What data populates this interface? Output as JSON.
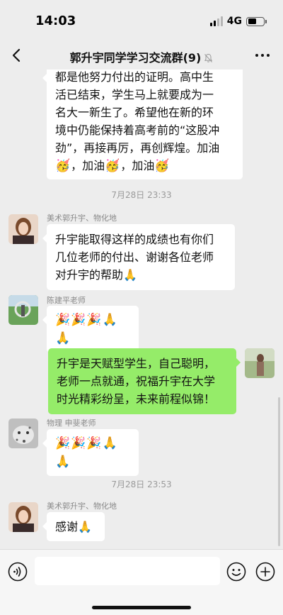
{
  "status": {
    "time": "14:03",
    "network": "4G"
  },
  "header": {
    "title": "郭升宇同学学习交流群(9)"
  },
  "messages": {
    "top_partial": {
      "lines": [
        "都是他努力付出的证明。高中生",
        "活已结束，学生马上就要成为一",
        "名大一新生了。希望他在新的环",
        "境中仍能保持着高考前的“这股冲",
        "劲”，再接再厉，再创辉煌。加油"
      ],
      "last_line": [
        "🥳",
        "，加油",
        "🥳",
        "，加油",
        "🥳"
      ]
    },
    "ts1": "7月28日 23:33",
    "msg1": {
      "sender": "美术郭升宇、物化地",
      "lines": [
        "升宇能取得这样的成绩也有你们",
        "几位老师的付出、谢谢各位老师",
        "对升宇的帮助🙏"
      ]
    },
    "msg2": {
      "sender": "陈建平老师",
      "text": "🎉🎉🎉🙏🙏"
    },
    "msg3": {
      "lines": [
        "升宇是天赋型学生，自己聪明，",
        "老师一点就通，祝福升宇在大学",
        "时光精彩纷呈，未来前程似锦！"
      ]
    },
    "msg4": {
      "sender": "物理 申斐老师",
      "text": "🎉🎉🎉🙏🙏"
    },
    "ts2": "7月28日 23:53",
    "msg5": {
      "sender": "美术郭升宇、物化地",
      "text": "感谢🙏"
    }
  },
  "input": {
    "placeholder": ""
  },
  "icons": {
    "back": "back-chevron-icon",
    "mute": "bell-muted-icon",
    "more": "more-dots-icon",
    "voice": "voice-icon",
    "emoji": "emoji-face-icon",
    "plus": "plus-circle-icon"
  },
  "colors": {
    "background": "#ededed",
    "my_bubble": "#95ec69",
    "other_bubble": "#ffffff"
  }
}
